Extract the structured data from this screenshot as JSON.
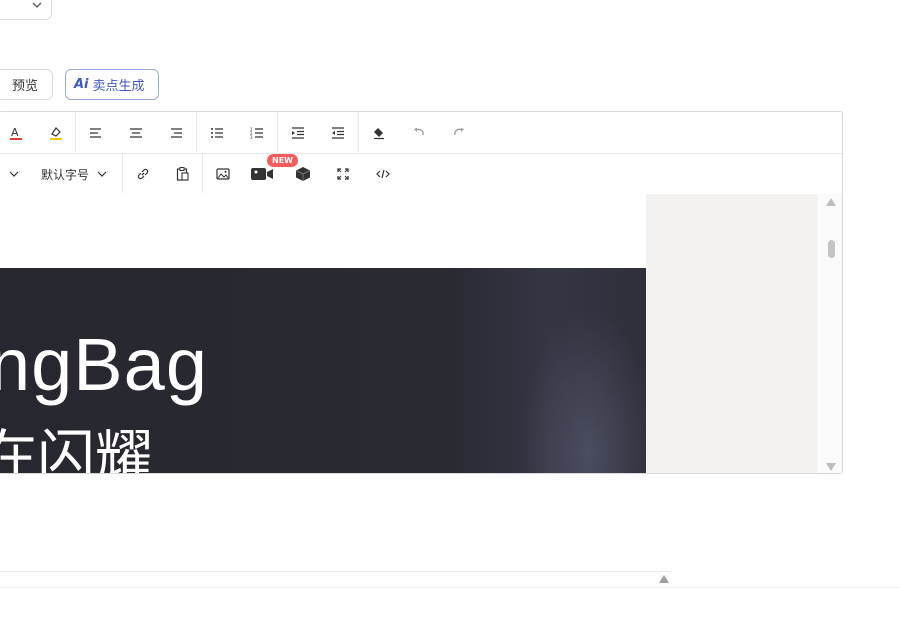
{
  "buttons": {
    "preview": "预览",
    "ai_generate": "卖点生成",
    "ai_icon_text": "Ai"
  },
  "toolbar": {
    "font_size": "默认字号",
    "new_badge": "NEW"
  },
  "content": {
    "banner_title": "ngBag",
    "banner_subtitle": "在闪耀"
  },
  "colors": {
    "accent": "#3e57c8",
    "badge": "#f25c5c",
    "banner_bg": "#27272f"
  }
}
